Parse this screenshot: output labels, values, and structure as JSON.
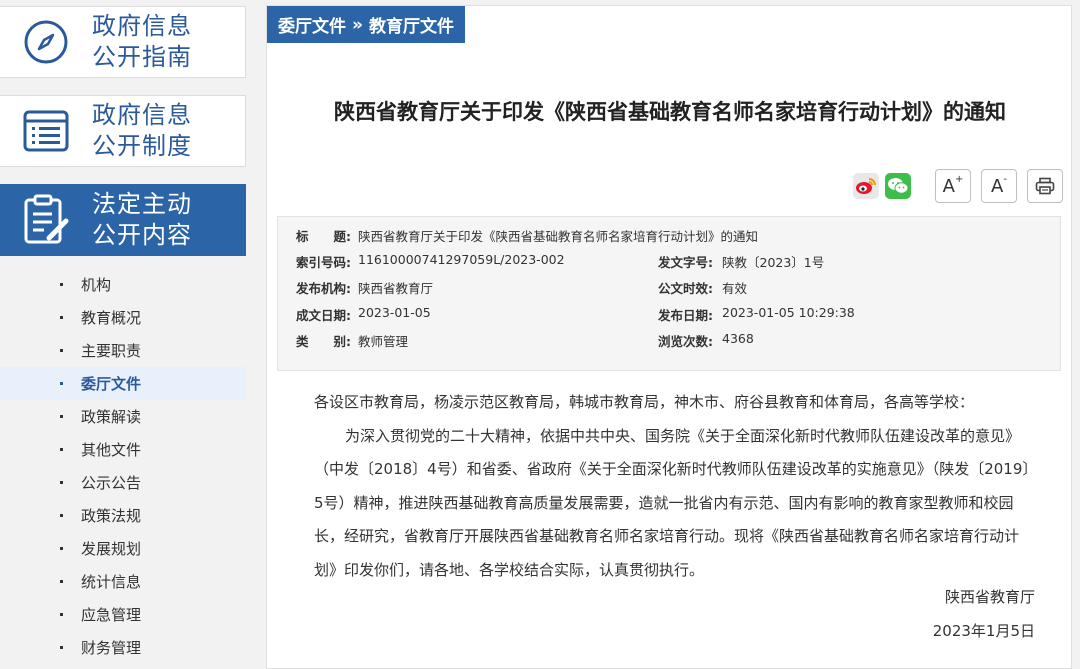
{
  "sidebar": {
    "cards": [
      {
        "line1": "政府信息",
        "line2": "公开指南",
        "icon": "compass-icon"
      },
      {
        "line1": "政府信息",
        "line2": "公开制度",
        "icon": "list-icon"
      },
      {
        "line1": "法定主动",
        "line2": "公开内容",
        "icon": "clipboard-edit-icon",
        "active": true
      }
    ],
    "items": [
      {
        "label": "机构"
      },
      {
        "label": "教育概况"
      },
      {
        "label": "主要职责"
      },
      {
        "label": "委厅文件",
        "active": true
      },
      {
        "label": "政策解读"
      },
      {
        "label": "其他文件"
      },
      {
        "label": "公示公告"
      },
      {
        "label": "政策法规"
      },
      {
        "label": "发展规划"
      },
      {
        "label": "统计信息"
      },
      {
        "label": "应急管理"
      },
      {
        "label": "财务管理"
      }
    ]
  },
  "breadcrumb": {
    "parent": "委厅文件",
    "separator": "»",
    "current": "教育厅文件"
  },
  "article": {
    "title": "陕西省教育厅关于印发《陕西省基础教育名师名家培育行动计划》的通知",
    "tools": {
      "font_increase": "A",
      "font_decrease": "A",
      "increase_sup": "+",
      "decrease_sup": "-"
    }
  },
  "meta": {
    "title_key": "标　　题:",
    "title_val": "陕西省教育厅关于印发《陕西省基础教育名师名家培育行动计划》的通知",
    "index_key": "索引号码:",
    "index_val": "11610000741297059L/2023-002",
    "docno_key": "发文字号:",
    "docno_val": "陕教〔2023〕1号",
    "org_key": "发布机构:",
    "org_val": "陕西省教育厅",
    "validity_key": "公文时效:",
    "validity_val": "有效",
    "created_key": "成文日期:",
    "created_val": "2023-01-05",
    "published_key": "发布日期:",
    "published_val": "2023-01-05 10:29:38",
    "category_key": "类　　别:",
    "category_val": "教师管理",
    "views_key": "浏览次数:",
    "views_val": "4368"
  },
  "content": {
    "addressee": "各设区市教育局，杨凌示范区教育局，韩城市教育局，神木市、府谷县教育和体育局，各高等学校：",
    "paragraph": "为深入贯彻党的二十大精神，依据中共中央、国务院《关于全面深化新时代教师队伍建设改革的意见》（中发〔2018〕4号）和省委、省政府《关于全面深化新时代教师队伍建设改革的实施意见》（陕发〔2019〕5号）精神，推进陕西基础教育高质量发展需要，造就一批省内有示范、国内有影响的教育家型教师和校园长，经研究，省教育厅开展陕西省基础教育名师名家培育行动。现将《陕西省基础教育名师名家培育行动计划》印发你们，请各地、各学校结合实际，认真贯彻执行。",
    "signature": "陕西省教育厅",
    "date": "2023年1月5日"
  },
  "colors": {
    "brand": "#2c64a8",
    "active_bg": "#e8f1fb",
    "wechat": "#3fbd4a"
  }
}
